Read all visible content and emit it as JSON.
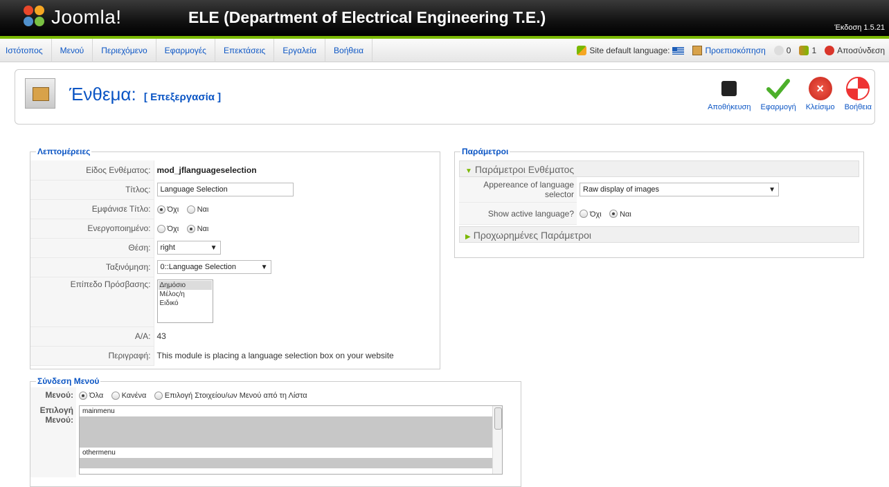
{
  "header": {
    "brand": "Joomla!",
    "site_title": "ELE (Department of Electrical Engineering T.E.)",
    "version": "Έκδοση 1.5.21"
  },
  "menubar": {
    "items": [
      "Ιστότοπος",
      "Μενού",
      "Περιεχόμενο",
      "Εφαρμογές",
      "Επεκτάσεις",
      "Εργαλεία",
      "Βοήθεια"
    ]
  },
  "status": {
    "default_language_label": "Site default language:",
    "preview": "Προεπισκόπηση",
    "messages_count": "0",
    "users_count": "1",
    "logout": "Αποσύνδεση"
  },
  "toolbar": {
    "title": "Ένθεμα:",
    "subtitle": "[ Επεξεργασία ]",
    "buttons": {
      "save": "Αποθήκευση",
      "apply": "Εφαρμογή",
      "close": "Κλείσιμο",
      "help": "Βοήθεια"
    }
  },
  "details": {
    "legend": "Λεπτομέρειες",
    "module_type_label": "Είδος Ενθέματος:",
    "module_type_value": "mod_jflanguageselection",
    "title_label": "Τίτλος:",
    "title_value": "Language Selection",
    "show_title_label": "Εμφάνισε Τίτλο:",
    "enabled_label": "Ενεργοποιημένο:",
    "no": "Όχι",
    "yes": "Ναι",
    "position_label": "Θέση:",
    "position_value": "right",
    "order_label": "Ταξινόμηση:",
    "order_value": "0::Language Selection",
    "access_label": "Επίπεδο Πρόσβασης:",
    "access_options": [
      "Δημόσιο",
      "Μέλος/η",
      "Ειδικό"
    ],
    "id_label": "Α/Α:",
    "id_value": "43",
    "description_label": "Περιγραφή:",
    "description_value": "This module is placing a language selection box on your website"
  },
  "params": {
    "legend": "Παράμετροι",
    "module_params_head": "Παράμετροι Ενθέματος",
    "appearance_label": "Appereance of language selector",
    "appearance_value": "Raw display of images",
    "show_active_label": "Show active language?",
    "no": "Όχι",
    "yes": "Ναι",
    "advanced_head": "Προχωρημένες Παράμετροι"
  },
  "menu_link": {
    "legend": "Σύνδεση Μενού",
    "menus_label": "Μενού:",
    "opt_all": "Όλα",
    "opt_none": "Κανένα",
    "opt_select": "Επιλογή Στοιχείου/ων Μενού από τη Λίστα",
    "select_label_1": "Επιλογή",
    "select_label_2": "Μενού:",
    "group_main": "mainmenu",
    "group_other": "othermenu"
  }
}
